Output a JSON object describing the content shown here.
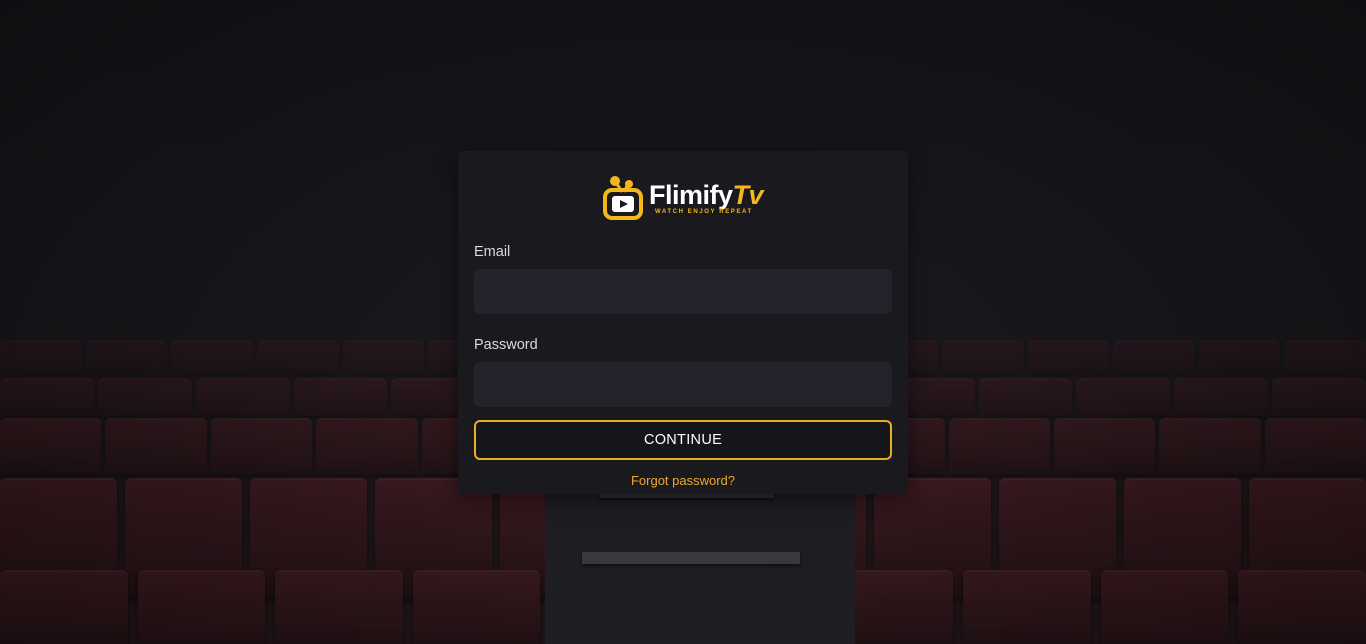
{
  "brand": {
    "name_part1": "Flimify",
    "name_part2": "Tv",
    "tagline": "WATCH ENJOY REPEAT",
    "logo_icon": "tv-play-icon",
    "accent_color": "#f4b81c"
  },
  "background": {
    "scene": "cinema-seats",
    "seat_color": "#3a1a20"
  },
  "form": {
    "email_label": "Email",
    "email_value": "",
    "email_placeholder": "",
    "password_label": "Password",
    "password_value": "",
    "password_placeholder": "",
    "submit_label": "CONTINUE",
    "forgot_label": "Forgot password?",
    "link_color": "#f0a82a"
  }
}
